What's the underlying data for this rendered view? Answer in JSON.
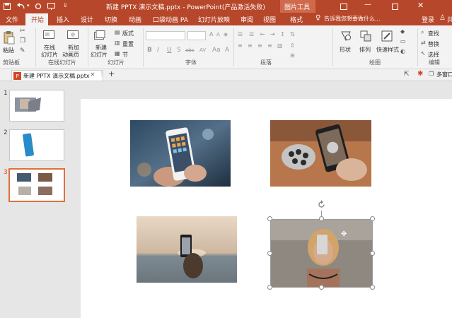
{
  "titlebar": {
    "doc_title": "新建 PPTX 演示文稿.pptx - PowerPoint(产品激活失败)",
    "context_tool": "图片工具",
    "login": "登录"
  },
  "tabs": [
    "文件",
    "开始",
    "插入",
    "设计",
    "切换",
    "动画",
    "口袋动画 PA",
    "幻灯片放映",
    "审阅",
    "视图",
    "格式"
  ],
  "active_tab": "开始",
  "tell_me": "告诉我您想要做什么...",
  "share": "共",
  "ribbon": {
    "paste": "粘贴",
    "clipboard_group": "剪贴板",
    "online_slides": [
      "在线",
      "幻灯片"
    ],
    "new_anim_slides": [
      "新加",
      "动画页"
    ],
    "online_slides_group": "在线幻灯片",
    "new_slide": [
      "新建",
      "幻灯片"
    ],
    "layout": "版式",
    "reset": "重置",
    "section": "节",
    "slides_group": "幻灯片",
    "font_group": "字体",
    "paragraph_group": "段落",
    "shape": "形状",
    "arrange": "排列",
    "quick_styles": "快速样式",
    "drawing_group": "绘图",
    "find": "查找",
    "replace": "替换",
    "select": "选择",
    "editing_group": "编辑",
    "font_buttons": [
      "B",
      "I",
      "U",
      "S",
      "abc",
      "AV",
      "Aa",
      "A"
    ]
  },
  "doc_tab": {
    "name": "新建 PPTX 演示文稿.pptx",
    "close": "×",
    "add": "+",
    "multi_window": "多窗口"
  },
  "slides": [
    "1",
    "2",
    "3"
  ],
  "active_slide": "3",
  "colors": {
    "accent": "#b7472a",
    "ribbon_bg": "#f3f3f3",
    "selection_border": "#e0703a"
  },
  "icons": {
    "save": "save-icon",
    "undo": "undo-icon",
    "redo": "redo-icon",
    "rotate": "rotate-handle-icon",
    "search": "search-icon",
    "user": "user-icon"
  }
}
